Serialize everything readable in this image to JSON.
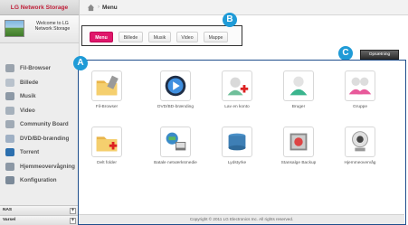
{
  "sidebar": {
    "brand": "LG Network Storage",
    "welcome": "Welcome to LG Network Storage",
    "items": [
      {
        "label": "Fil-Browser",
        "icon": "folder-icon",
        "color": "#9aa3ad"
      },
      {
        "label": "Billede",
        "icon": "image-icon",
        "color": "#b9c2cc"
      },
      {
        "label": "Musik",
        "icon": "music-icon",
        "color": "#8d99a6"
      },
      {
        "label": "Video",
        "icon": "video-icon",
        "color": "#a6b1bc"
      },
      {
        "label": "Community Board",
        "icon": "community-icon",
        "color": "#a0aab5"
      },
      {
        "label": "DVD/BD-brænding",
        "icon": "disc-icon",
        "color": "#9fb0c4"
      },
      {
        "label": "Torrent",
        "icon": "torrent-icon",
        "color": "#2c6fae"
      },
      {
        "label": "Hjemmeovervågning",
        "icon": "camera-icon",
        "color": "#8c98a5"
      },
      {
        "label": "Konfiguration",
        "icon": "settings-icon",
        "color": "#7c8a99"
      }
    ],
    "bottom": [
      {
        "label": "NAS",
        "toggle": "+"
      },
      {
        "label": "Varsel",
        "toggle": "+"
      }
    ]
  },
  "topbar": {
    "crumb_sep": "›",
    "crumb": "Menu"
  },
  "tabs": [
    {
      "label": "Menu",
      "active": true
    },
    {
      "label": "Billede",
      "active": false
    },
    {
      "label": "Musik",
      "active": false
    },
    {
      "label": "Video",
      "active": false
    },
    {
      "label": "Mappe",
      "active": false
    }
  ],
  "button_label": "Opsætning",
  "badges": {
    "a": "A",
    "b": "B",
    "c": "C"
  },
  "apps": [
    {
      "label": "Fil-Browser",
      "icon": "folder-icon"
    },
    {
      "label": "DVD/BD-brænding",
      "icon": "disc-burn-icon"
    },
    {
      "label": "Lav en konto",
      "icon": "add-user-icon"
    },
    {
      "label": "Bruger",
      "icon": "user-icon"
    },
    {
      "label": "Gruppe",
      "icon": "group-icon"
    },
    {
      "label": "Delt folder",
      "icon": "shared-folder-icon"
    },
    {
      "label": "Batale netværksmedie",
      "icon": "network-media-icon"
    },
    {
      "label": "Lydstyrke",
      "icon": "volume-icon"
    },
    {
      "label": "Stansalge Backup",
      "icon": "backup-icon"
    },
    {
      "label": "Hjemmeovervåg",
      "icon": "webcam-icon"
    }
  ],
  "footer": "Copyright © 2011 LG Electronics Inc. All rights reserved.",
  "colors": {
    "accent": "#e0176b",
    "badge": "#1f9bd7",
    "frame": "#1f4e8c"
  }
}
